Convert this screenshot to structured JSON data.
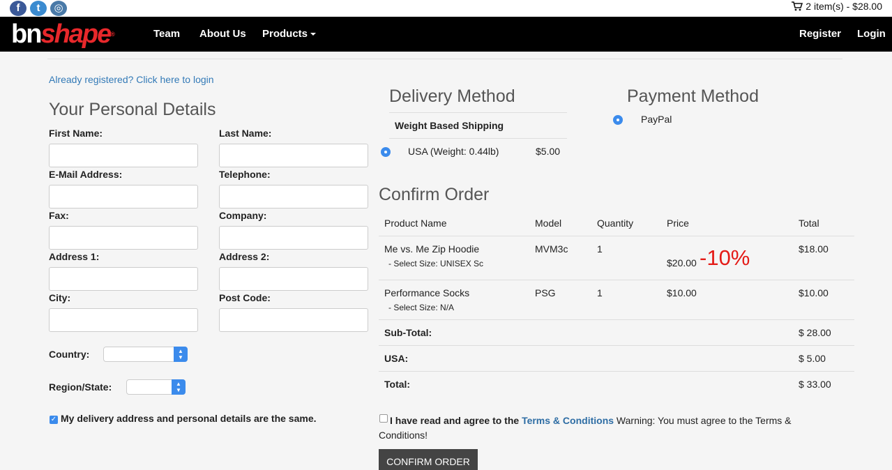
{
  "topbar": {
    "social": [
      {
        "icon": "facebook-icon",
        "glyph": "f"
      },
      {
        "icon": "twitter-icon",
        "glyph": "t"
      },
      {
        "icon": "instagram-icon",
        "glyph": "◎"
      }
    ],
    "cart_text": "2 item(s) - $28.00"
  },
  "nav": {
    "logo_bn": "bn",
    "logo_shape": "shape",
    "logo_reg": "®",
    "team": "Team",
    "about": "About Us",
    "products": "Products",
    "register": "Register",
    "login": "Login"
  },
  "personal": {
    "already_registered": "Already registered? Click here to login",
    "title": "Your Personal Details",
    "first_name": "First Name:",
    "last_name": "Last Name:",
    "email": "E-Mail Address:",
    "telephone": "Telephone:",
    "fax": "Fax:",
    "company": "Company:",
    "address1": "Address 1:",
    "address2": "Address 2:",
    "city": "City:",
    "postcode": "Post Code:",
    "country": "Country:",
    "region": "Region/State:",
    "same_address": "My delivery address and personal details are the same.",
    "same_address_checked": true
  },
  "delivery": {
    "title": "Delivery Method",
    "method_name": "Weight Based Shipping",
    "option": "USA  (Weight: 0.44lb)",
    "price": "$5.00"
  },
  "payment": {
    "title": "Payment Method",
    "option": "PayPal"
  },
  "order": {
    "title": "Confirm Order",
    "headers": {
      "product": "Product Name",
      "model": "Model",
      "quantity": "Quantity",
      "price": "Price",
      "total": "Total"
    },
    "items": [
      {
        "name": "Me vs. Me Zip Hoodie",
        "option": "- Select Size: UNISEX Sc",
        "model": "MVM3c",
        "qty": "1",
        "price": "$20.00",
        "discount": "-10%",
        "total": "$18.00"
      },
      {
        "name": "Performance Socks",
        "option": "- Select Size: N/A",
        "model": "PSG",
        "qty": "1",
        "price": "$10.00",
        "total": "$10.00"
      }
    ],
    "subtotal_label": "Sub-Total:",
    "subtotal": "$ 28.00",
    "shipping_label": "USA:",
    "shipping": "$ 5.00",
    "total_label": "Total:",
    "total": "$ 33.00"
  },
  "terms": {
    "prefix": "I have read and agree to the",
    "link": "Terms & Conditions",
    "warning": "Warning: You must agree to the Terms &",
    "warning_cont": "Conditions!"
  },
  "confirm_button": "CONFIRM ORDER",
  "colors": {
    "navbar": "#000000",
    "accent_blue": "#337ab7",
    "discount_red": "#e41b17",
    "logo_red": "#e8282b",
    "button_dark": "#444444"
  }
}
